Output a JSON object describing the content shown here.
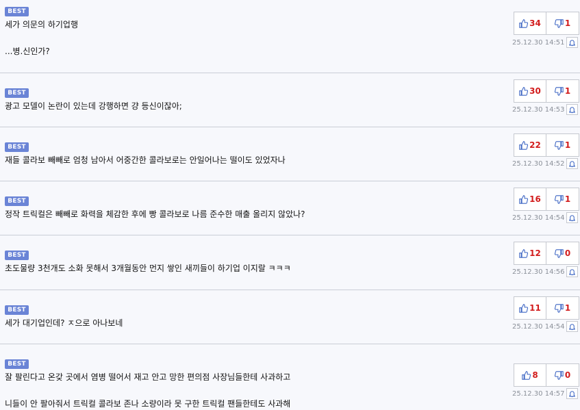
{
  "badge_label": "BEST",
  "colors": {
    "badge": "#6a84d6",
    "count": "#d21d1d",
    "icon": "#3a63c2"
  },
  "comments": [
    {
      "lines": [
        "세가 의문의 하기업행",
        "",
        "...병.신인가?"
      ],
      "likes": "34",
      "dislikes": "1",
      "date": "25.12.30 14:51"
    },
    {
      "lines": [
        "광고 모델이 논란이 있는데 강행하면 걍 등신이잖아;"
      ],
      "likes": "30",
      "dislikes": "1",
      "date": "25.12.30 14:53"
    },
    {
      "lines": [
        "재들 콜라보 빼빼로 엄청 남아서 어중간한 콜라보로는 안일어나는 떨이도 있었자나"
      ],
      "likes": "22",
      "dislikes": "1",
      "date": "25.12.30 14:52"
    },
    {
      "lines": [
        "정작 트릭컬은 빼빼로 화력을 체감한 후에 빵 콜라보로 나름 준수한 매출 올리지 않았나?"
      ],
      "likes": "16",
      "dislikes": "1",
      "date": "25.12.30 14:54"
    },
    {
      "lines": [
        "초도물량 3천개도 소화 못해서 3개월동안 먼지 쌓인 새끼들이 하기업 이지랄 ㅋㅋㅋ"
      ],
      "likes": "12",
      "dislikes": "0",
      "date": "25.12.30 14:56"
    },
    {
      "lines": [
        "세가 대기업인데? ㅈ으로 아나보네"
      ],
      "likes": "11",
      "dislikes": "1",
      "date": "25.12.30 14:54"
    },
    {
      "lines": [
        "잘 팔린다고 온갖 곳에서 염병 떨어서 재고 안고 망한 편의점 사장님들한테 사과하고",
        "",
        "니들이 안 팔아줘서 트릭컬 콜라보 존나 소량이라 못 구한 트릭컬 팬들한테도 사과해"
      ],
      "likes": "8",
      "dislikes": "0",
      "date": "25.12.30 14:57"
    }
  ]
}
